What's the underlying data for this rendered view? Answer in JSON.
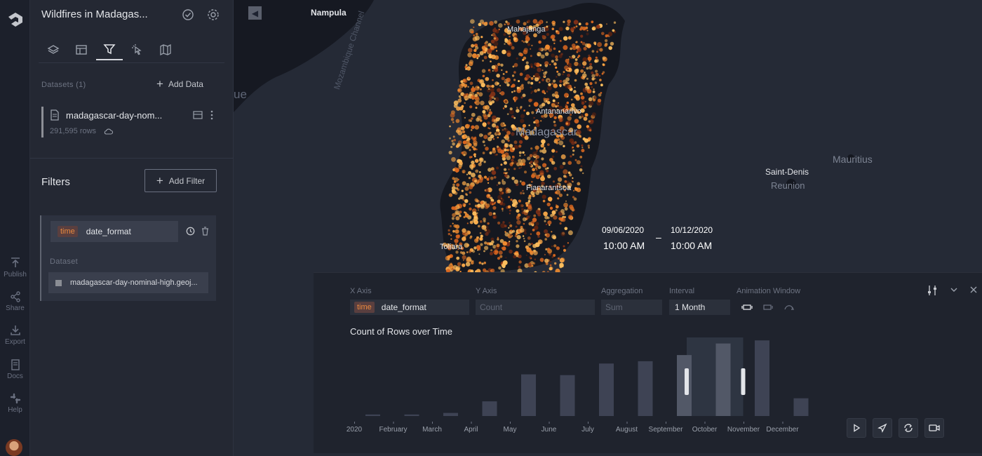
{
  "app": {
    "map_title": "Wildfires in Madagas...",
    "rail": [
      {
        "label": "Publish",
        "icon": "publish-icon"
      },
      {
        "label": "Share",
        "icon": "share-icon"
      },
      {
        "label": "Export",
        "icon": "export-icon"
      },
      {
        "label": "Docs",
        "icon": "docs-icon"
      },
      {
        "label": "Help",
        "icon": "help-icon"
      }
    ]
  },
  "datasets": {
    "section_label": "Datasets (1)",
    "add_data_label": "Add Data",
    "items": [
      {
        "name": "madagascar-day-nom...",
        "rows": "291,595 rows"
      }
    ]
  },
  "filters": {
    "title": "Filters",
    "add_filter_label": "Add Filter",
    "field_type": "time",
    "field_name": "date_format",
    "dataset_label": "Dataset",
    "dataset_name": "madagascar-day-nominal-high.geoj..."
  },
  "map": {
    "labels": {
      "nampula": "Nampula",
      "mahajanga": "Mahajanga",
      "antananarivo": "Antananarivo",
      "madagascar": "Madagascar",
      "fianarantsoa": "Fianarantsoa",
      "toliara": "Toliara",
      "mozambique_channel": "Mozambique Channel",
      "mauritius": "Mauritius",
      "saint_denis": "Saint-Denis",
      "reunion": "Reunion",
      "partial_e": "ue"
    },
    "time_range": {
      "start_date": "09/06/2020",
      "start_time": "10:00 AM",
      "end_date": "10/12/2020",
      "end_time": "10:00 AM",
      "separator": "–"
    }
  },
  "timeline": {
    "x_axis_label": "X Axis",
    "x_axis_type": "time",
    "x_axis_value": "date_format",
    "y_axis_label": "Y Axis",
    "y_axis_placeholder": "Count",
    "aggregation_label": "Aggregation",
    "aggregation_placeholder": "Sum",
    "interval_label": "Interval",
    "interval_value": "1 Month",
    "animation_label": "Animation Window",
    "chart_title": "Count of Rows over Time",
    "highlight_color": "#e9893e",
    "bar_color": "#3e4354"
  },
  "chart_data": {
    "type": "bar",
    "title": "Count of Rows over Time",
    "categories": [
      "2020",
      "February",
      "March",
      "April",
      "May",
      "June",
      "July",
      "August",
      "September",
      "October",
      "November",
      "December"
    ],
    "values": [
      2,
      2,
      4,
      19,
      54,
      53,
      68,
      71,
      79,
      94,
      98,
      23
    ],
    "selected_range": [
      "September",
      "October"
    ],
    "xlabel": "",
    "ylabel": "",
    "ylim": [
      0,
      100
    ]
  }
}
